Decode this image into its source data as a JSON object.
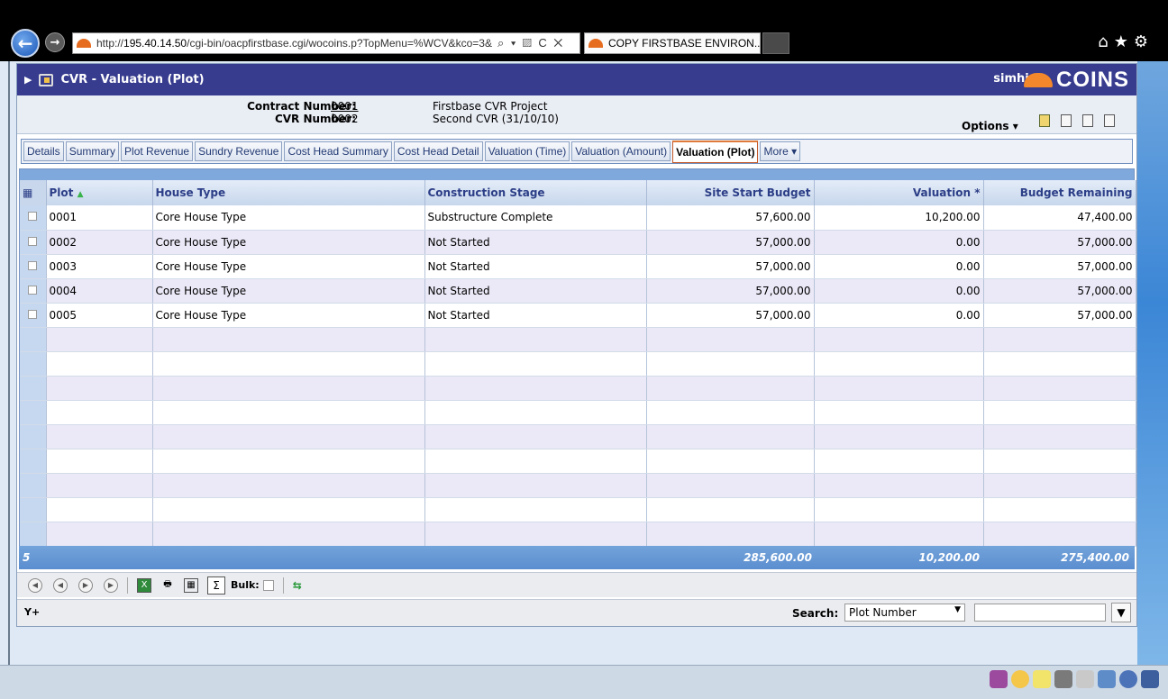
{
  "browser": {
    "url_prefix": "http://",
    "url_host": "195.40.14.50",
    "url_path": "/cgi-bin/oacpfirstbase.cgi/wocoins.p?TopMenu=%WCV&kco=3&",
    "url_controls": "⌕ ▾ ▨ C ✕",
    "tab_title": "COPY FIRSTBASE ENVIRON...",
    "tab_close": "✕",
    "right_icons": "⌂★⚙"
  },
  "app": {
    "title": "CVR - Valuation (Plot)",
    "user": "simhin",
    "logo": "COINS",
    "accent": "#373c8f"
  },
  "header": {
    "contract_label": "Contract Number:",
    "contract_value": "0001",
    "cvr_label": "CVR Number:",
    "cvr_value": "0002",
    "project_name": "Firstbase CVR Project",
    "cvr_name": "Second CVR (31/10/10)",
    "options_label": "Options ▾"
  },
  "tabs": [
    {
      "label": "Details"
    },
    {
      "label": "Summary"
    },
    {
      "label": "Plot Revenue"
    },
    {
      "label": "Sundry Revenue"
    },
    {
      "label": "Cost Head Summary"
    },
    {
      "label": "Cost Head Detail"
    },
    {
      "label": "Valuation (Time)"
    },
    {
      "label": "Valuation (Amount)"
    },
    {
      "label": "Valuation (Plot)"
    },
    {
      "label": "More ▾"
    }
  ],
  "grid": {
    "columns": [
      "Plot",
      "House Type",
      "Construction Stage",
      "Site Start Budget",
      "Valuation *",
      "Budget Remaining"
    ],
    "rows": [
      [
        "0001",
        "Core House Type",
        "Substructure Complete",
        "57,600.00",
        "10,200.00",
        "47,400.00"
      ],
      [
        "0002",
        "Core House Type",
        "Not Started",
        "57,000.00",
        "0.00",
        "57,000.00"
      ],
      [
        "0003",
        "Core House Type",
        "Not Started",
        "57,000.00",
        "0.00",
        "57,000.00"
      ],
      [
        "0004",
        "Core House Type",
        "Not Started",
        "57,000.00",
        "0.00",
        "57,000.00"
      ],
      [
        "0005",
        "Core House Type",
        "Not Started",
        "57,000.00",
        "0.00",
        "57,000.00"
      ]
    ],
    "totals": {
      "count": "5",
      "site_start_budget": "285,600.00",
      "valuation": "10,200.00",
      "budget_remaining": "275,400.00"
    }
  },
  "toolbar": {
    "bulk_label": "Bulk:",
    "sigma": "Σ"
  },
  "search": {
    "label": "Search:",
    "selected": "Plot Number",
    "value": ""
  }
}
